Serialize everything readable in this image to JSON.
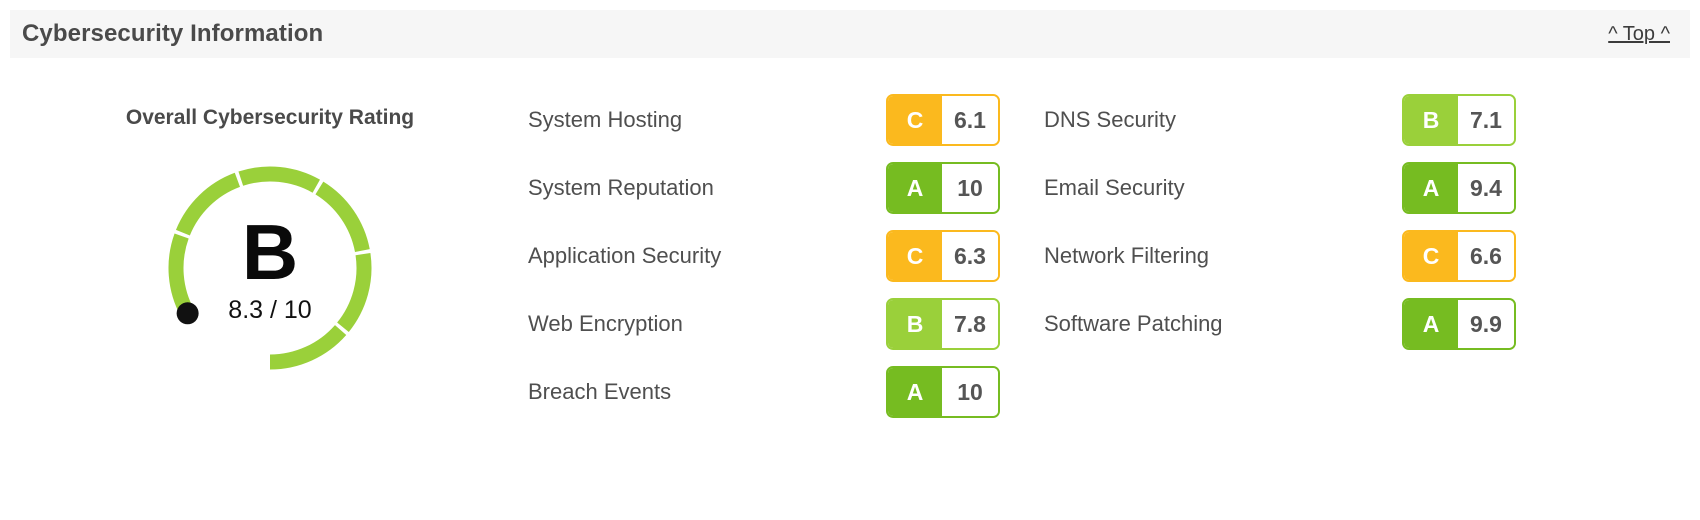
{
  "header": {
    "title": "Cybersecurity Information",
    "top_link": "^ Top ^"
  },
  "gauge": {
    "heading": "Overall Cybersecurity Rating",
    "grade": "B",
    "score_text": "8.3 / 10",
    "score_value": 8.3,
    "score_max": 10,
    "arc_color": "#9ad03a",
    "track_color": "#cfcfcf",
    "marker_color": "#111111",
    "segments": 6
  },
  "grade_colors": {
    "A": "#76bc21",
    "B": "#9ad03a",
    "C": "#fbb91e",
    "D": "#f5821f",
    "F": "#e03127"
  },
  "metrics": {
    "left_column": [
      {
        "label": "System Hosting",
        "grade": "C",
        "value": "6.1"
      },
      {
        "label": "System Reputation",
        "grade": "A",
        "value": "10"
      },
      {
        "label": "Application Security",
        "grade": "C",
        "value": "6.3"
      },
      {
        "label": "Web Encryption",
        "grade": "B",
        "value": "7.8"
      },
      {
        "label": "Breach Events",
        "grade": "A",
        "value": "10"
      }
    ],
    "right_column": [
      {
        "label": "DNS Security",
        "grade": "B",
        "value": "7.1"
      },
      {
        "label": "Email Security",
        "grade": "A",
        "value": "9.4"
      },
      {
        "label": "Network Filtering",
        "grade": "C",
        "value": "6.6"
      },
      {
        "label": "Software Patching",
        "grade": "A",
        "value": "9.9"
      }
    ]
  }
}
